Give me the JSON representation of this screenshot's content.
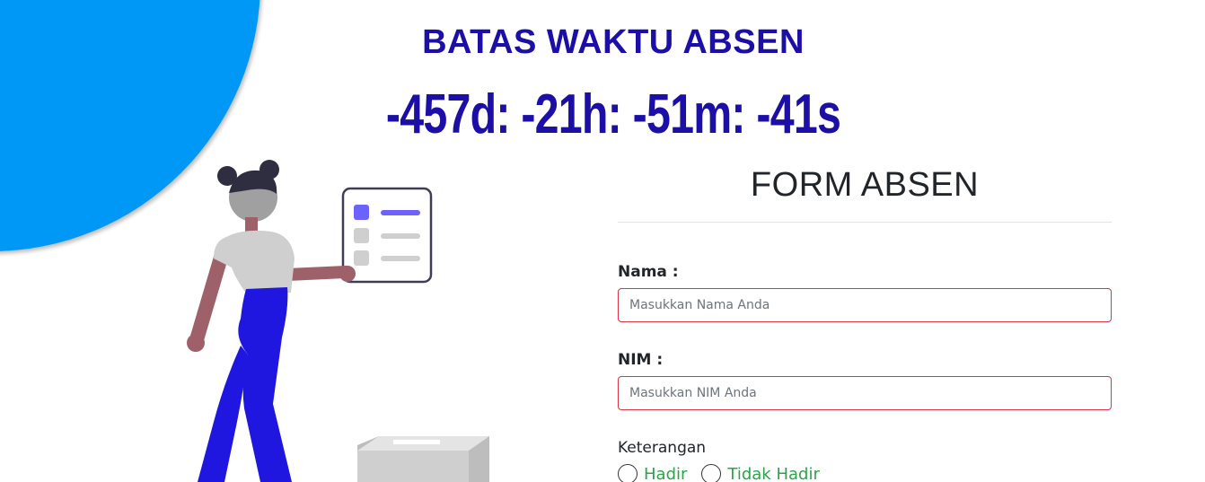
{
  "countdown": {
    "title": "BATAS WAKTU ABSEN",
    "value": "-457d: -21h: -51m: -41s"
  },
  "form": {
    "title": "FORM ABSEN",
    "nama": {
      "label": "Nama :",
      "placeholder": "Masukkan Nama Anda",
      "value": ""
    },
    "nim": {
      "label": "NIM :",
      "placeholder": "Masukkan NIM Anda",
      "value": ""
    },
    "keterangan": {
      "label": "Keterangan",
      "options": [
        "Hadir",
        "Tidak Hadir"
      ]
    }
  },
  "colors": {
    "accent_blue": "#0098f7",
    "countdown_text": "#1c0fa8",
    "invalid_border": "#dc3545",
    "option_text": "#28a745",
    "figure_pants": "#1f17e0",
    "checklist_accent": "#6c63ff"
  },
  "icons": {
    "illustration": "woman-voting-checklist-illustration"
  }
}
